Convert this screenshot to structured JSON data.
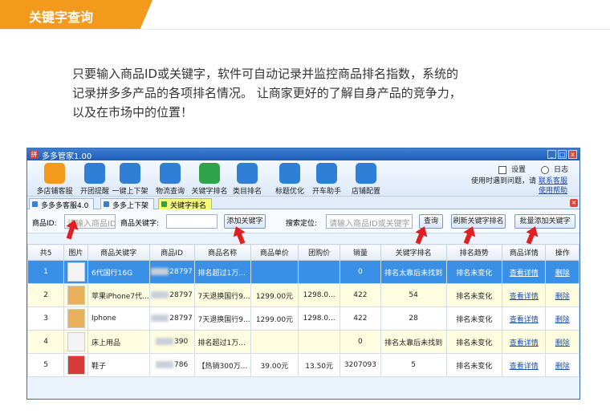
{
  "banner": {
    "title": "关键字查询"
  },
  "intro": {
    "lines": [
      "只要输入商品ID或关键字，软件可自动记录并监控商品排名指数，系统的",
      "记录拼多多产品的各项排名情况。  让商家更好的了解自身产品的竞争力，",
      "以及在市场中的位置！"
    ]
  },
  "window": {
    "title": "多多管家1.00",
    "min": "_",
    "max": "□",
    "close": "x",
    "toolbar": [
      {
        "label": "多店铺客服",
        "icon": "avatar-icon",
        "color": "#f39a1c"
      },
      {
        "label": "开团提醒",
        "icon": "group-icon",
        "color": "#2f7fd6"
      },
      {
        "label": "一键上下架",
        "icon": "grid-icon",
        "color": "#2f7fd6"
      },
      {
        "label": "物流查询",
        "icon": "truck-icon",
        "color": "#2f7fd6"
      },
      {
        "label": "关键字排名",
        "icon": "bar-chart-icon",
        "color": "#2fa24a"
      },
      {
        "label": "类目排名",
        "icon": "search-icon",
        "color": "#2f7fd6"
      },
      {
        "label": "标题优化",
        "icon": "pencil-icon",
        "color": "#2f7fd6"
      },
      {
        "label": "开车助手",
        "icon": "car-icon",
        "color": "#2f7fd6"
      },
      {
        "label": "店铺配置",
        "icon": "gear-icon",
        "color": "#2f7fd6"
      }
    ],
    "settings": "设置",
    "log": "日志",
    "help_text": "使用时遇到问题，请",
    "contact": "联系客服",
    "usage_help": "使用帮助",
    "tabs": [
      "多多多客服4.0",
      "多多上下架",
      "关键字排名"
    ],
    "search": {
      "id_label": "商品ID:",
      "id_placeholder": "请输入商品ID",
      "kw_label": "商品关键字:",
      "kw_value": "",
      "add_keyword": "添加关键字",
      "locate_label": "搜索定位:",
      "locate_placeholder": "请输入商品ID或关键字",
      "query": "查询",
      "refresh": "刷新关键字排名",
      "batch_add": "批量添加关键字"
    },
    "table": {
      "headers": [
        "共5",
        "图片",
        "商品关键字",
        "商品ID",
        "商品名称",
        "商品单价",
        "团购价",
        "销量",
        "关键字排名",
        "排名趋势",
        "商品详情",
        "操作"
      ],
      "rows": [
        {
          "n": "1",
          "kw": "6代国行16G",
          "id_tail": "28797",
          "name": "排名超过1万...",
          "price": "",
          "group": "",
          "sales": "0",
          "rank": "排名太靠后未找到",
          "trend": "排名未变化",
          "detail": "查看详情",
          "op": "删除"
        },
        {
          "n": "2",
          "kw": "苹果iPhone7代...",
          "id_tail": "28797",
          "name": "7天退换国行9...",
          "price": "1299.00元",
          "group": "1298.0...",
          "sales": "422",
          "rank": "54",
          "trend": "排名未变化",
          "detail": "查看详情",
          "op": "删除"
        },
        {
          "n": "3",
          "kw": "Iphone",
          "id_tail": "28797",
          "name": "7天退换国行9...",
          "price": "1299.00元",
          "group": "1298.0...",
          "sales": "422",
          "rank": "28",
          "trend": "排名未变化",
          "detail": "查看详情",
          "op": "删除"
        },
        {
          "n": "4",
          "kw": "床上用品",
          "id_tail": "390",
          "name": "排名超过1万...",
          "price": "",
          "group": "",
          "sales": "0",
          "rank": "排名太靠后未找到",
          "trend": "排名未变化",
          "detail": "查看详情",
          "op": "删除"
        },
        {
          "n": "5",
          "kw": "鞋子",
          "id_tail": "786",
          "name": "【热销300万...",
          "price": "39.00元",
          "group": "13.50元",
          "sales": "3207093",
          "rank": "5",
          "trend": "排名未变化",
          "detail": "查看详情",
          "op": "删除"
        }
      ]
    }
  },
  "colors": {
    "accent": "#f39a1c",
    "selection": "#3a8fe6",
    "highlight": "#e02020"
  }
}
